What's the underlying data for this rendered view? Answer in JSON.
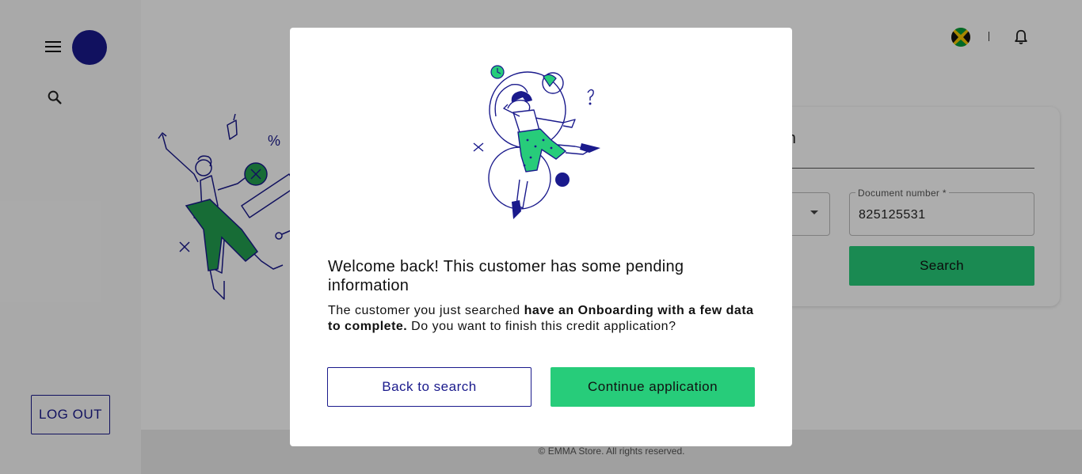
{
  "sidebar": {
    "menu_icon": "hamburger-menu-icon",
    "search_icon": "search-icon",
    "logout_label": "LOG OUT"
  },
  "header": {
    "country_flag": "jamaica-flag-icon",
    "notifications_icon": "bell-icon"
  },
  "search_card": {
    "title": "arch",
    "document_number_label": "Document number *",
    "document_number_value": "825125531",
    "search_button_label": "Search"
  },
  "footer": {
    "copyright": "© EMMA Store. All rights reserved."
  },
  "modal": {
    "title": "Welcome back! This customer has some pending information",
    "body_prefix": "The customer you just searched ",
    "body_bold": "have an Onboarding with a few data to complete.",
    "body_suffix": " Do you want to finish this credit application?",
    "back_button_label": "Back to search",
    "continue_button_label": "Continue application"
  },
  "colors": {
    "brand_navy": "#1a1a8c",
    "accent_green": "#27cc7a",
    "overlay": "rgba(0,0,0,0.32)"
  }
}
